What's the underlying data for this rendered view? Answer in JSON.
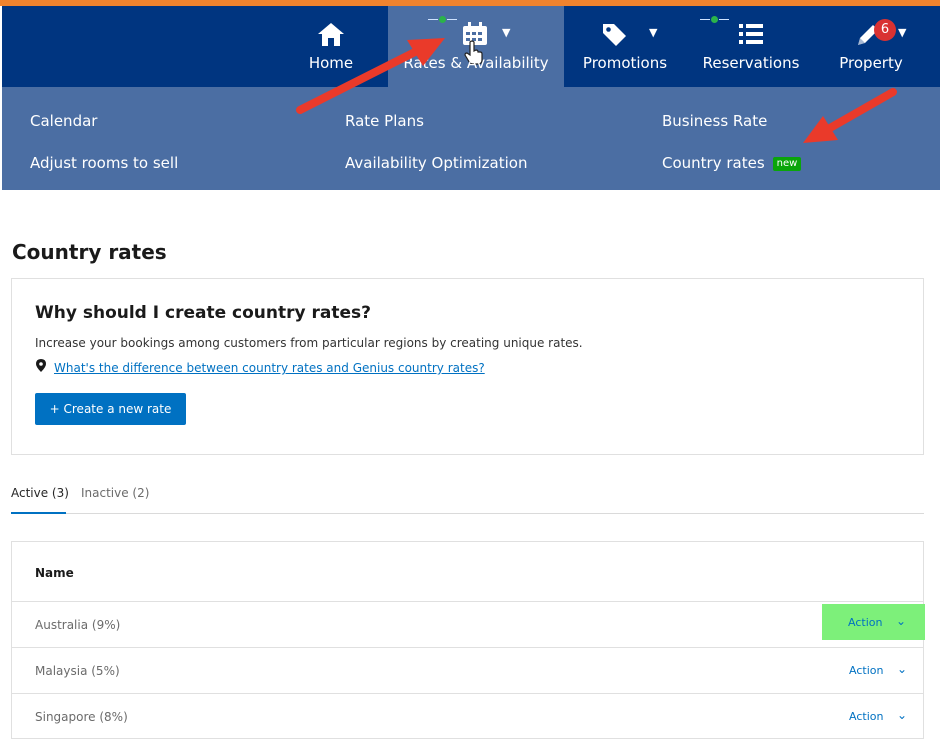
{
  "nav": {
    "items": [
      {
        "label": "Home",
        "icon": "home-icon"
      },
      {
        "label": "Rates & Availability",
        "icon": "calendar-icon"
      },
      {
        "label": "Promotions",
        "icon": "tag-icon"
      },
      {
        "label": "Reservations",
        "icon": "list-icon"
      },
      {
        "label": "Property",
        "icon": "pencil-icon",
        "badge": "6"
      }
    ]
  },
  "submenu": {
    "calendar": "Calendar",
    "adjust_rooms": "Adjust rooms to sell",
    "rate_plans": "Rate Plans",
    "availability_optimization": "Availability Optimization",
    "business_rate": "Business Rate",
    "country_rates": "Country rates",
    "new_badge": "new"
  },
  "main": {
    "title": "Country rates",
    "info": {
      "heading": "Why should I create country rates?",
      "text": "Increase your bookings among customers from particular regions by creating unique rates.",
      "link": "What's the difference between country rates and Genius country rates?",
      "button": "+ Create a new rate"
    },
    "tabs": [
      {
        "label": "Active (3)"
      },
      {
        "label": "Inactive (2)"
      }
    ],
    "table": {
      "header": "Name",
      "rows": [
        {
          "name": "Australia (9%)",
          "action": "Action"
        },
        {
          "name": "Malaysia (5%)",
          "action": "Action"
        },
        {
          "name": "Singapore (8%)",
          "action": "Action"
        }
      ]
    }
  },
  "colors": {
    "nav_bg": "#003580",
    "submenu_bg": "#4b6ea3",
    "accent": "#0071c2",
    "highlight": "#7df07a",
    "annotation_arrow": "#ea3a2a",
    "top_line": "#f0832e"
  }
}
